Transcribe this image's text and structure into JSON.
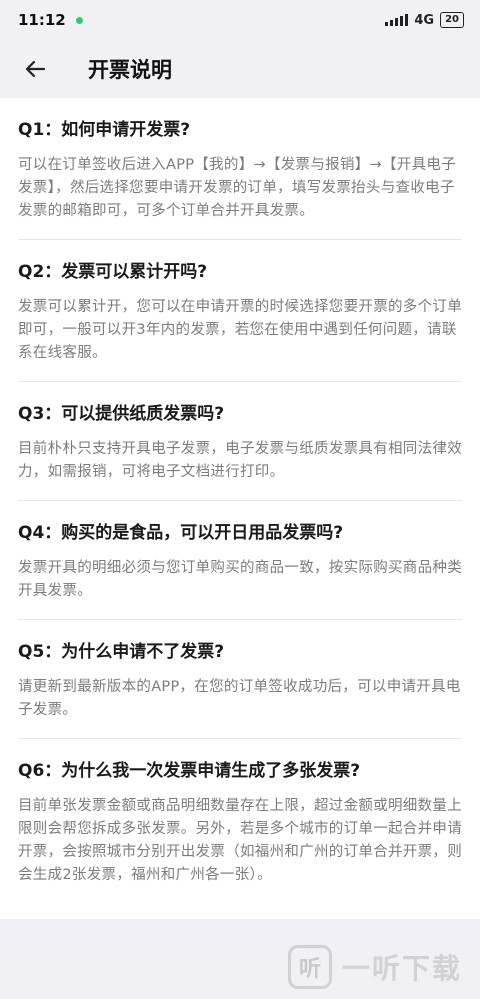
{
  "status_bar": {
    "time": "11:12",
    "network": "4G",
    "battery": "20",
    "colors": {
      "notification_dot": "#2ecc71"
    }
  },
  "navbar": {
    "back_icon": "arrow-left-icon",
    "title": "开票说明"
  },
  "faq": [
    {
      "question": "Q1：如何申请开发票?",
      "answer": "可以在订单签收后进入APP【我的】→【发票与报销】→【开具电子发票】，然后选择您要申请开发票的订单，填写发票抬头与查收电子发票的邮箱即可，可多个订单合并开具发票。"
    },
    {
      "question": "Q2：发票可以累计开吗?",
      "answer": "发票可以累计开，您可以在申请开票的时候选择您要开票的多个订单即可，一般可以开3年内的发票，若您在使用中遇到任何问题，请联系在线客服。"
    },
    {
      "question": "Q3：可以提供纸质发票吗?",
      "answer": "目前朴朴只支持开具电子发票，电子发票与纸质发票具有相同法律效力，如需报销，可将电子文档进行打印。"
    },
    {
      "question": "Q4：购买的是食品，可以开日用品发票吗?",
      "answer": "发票开具的明细必须与您订单购买的商品一致，按实际购买商品种类开具发票。"
    },
    {
      "question": "Q5：为什么申请不了发票?",
      "answer": "请更新到最新版本的APP，在您的订单签收成功后，可以申请开具电子发票。"
    },
    {
      "question": "Q6：为什么我一次发票申请生成了多张发票?",
      "answer": "目前单张发票金额或商品明细数量存在上限，超过金额或明细数量上限则会帮您拆成多张发票。另外，若是多个城市的订单一起合并申请开票，会按照城市分别开出发票（如福州和广州的订单合并开票，则会生成2张发票，福州和广州各一张）。"
    }
  ],
  "watermark": {
    "logo_char": "听",
    "text": "一听下载"
  }
}
